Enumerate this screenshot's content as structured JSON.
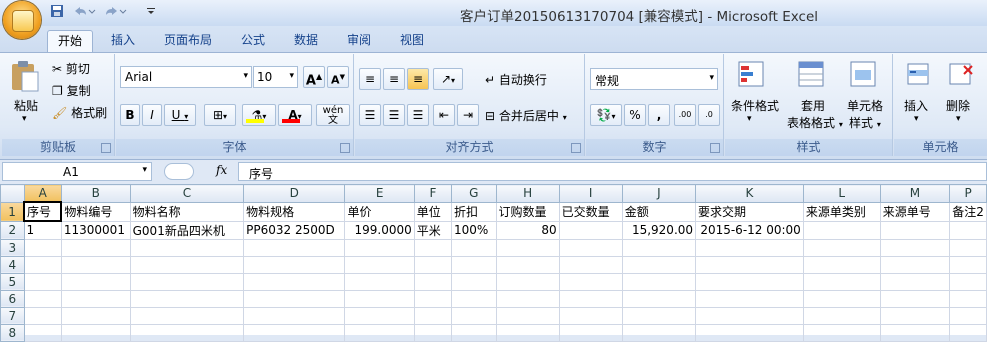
{
  "window": {
    "title": "客户订单20150613170704  [兼容模式] - Microsoft Excel"
  },
  "quick_access": {
    "save": "save-icon",
    "undo": "undo-icon",
    "redo": "redo-icon"
  },
  "tabs": [
    {
      "label": "开始",
      "active": true
    },
    {
      "label": "插入"
    },
    {
      "label": "页面布局"
    },
    {
      "label": "公式"
    },
    {
      "label": "数据"
    },
    {
      "label": "审阅"
    },
    {
      "label": "视图"
    }
  ],
  "ribbon": {
    "clipboard": {
      "paste": "粘贴",
      "cut": "剪切",
      "copy": "复制",
      "format_painter": "格式刷",
      "label": "剪贴板"
    },
    "font": {
      "name": "Arial",
      "size": "10",
      "bold": "B",
      "italic": "I",
      "underline": "U",
      "phonetic": "wén 文",
      "label": "字体",
      "fill_color": "#ffff00",
      "font_color": "#ff0000"
    },
    "alignment": {
      "wrap": "自动换行",
      "merge": "合并后居中",
      "label": "对齐方式"
    },
    "number": {
      "format": "常规",
      "percent": "%",
      "comma": ",",
      "inc_decimal": ".00",
      "dec_decimal": ".0",
      "label": "数字"
    },
    "styles": {
      "conditional": "条件格式",
      "table_format": "套用",
      "table_format_line2": "表格格式",
      "cell_styles": "单元格",
      "cell_styles_line2": "样式",
      "label": "样式"
    },
    "cells": {
      "insert": "插入",
      "delete": "删除",
      "label": "单元格"
    }
  },
  "formula_bar": {
    "name_box": "A1",
    "fx": "fx",
    "content": "序号"
  },
  "sheet": {
    "columns": [
      "A",
      "B",
      "C",
      "D",
      "E",
      "F",
      "G",
      "H",
      "I",
      "J",
      "K",
      "L",
      "M",
      "P"
    ],
    "rows": [
      {
        "num": "1",
        "cells": [
          "序号",
          "物料编号",
          "物料名称",
          "物料规格",
          "单价",
          "单位",
          "折扣",
          "订购数量",
          "已交数量",
          "金额",
          "要求交期",
          "来源单类别",
          "来源单号",
          "备注2"
        ]
      },
      {
        "num": "2",
        "cells": [
          "1",
          "11300001",
          "G001新品四米机",
          "PP6032 2500D",
          "199.0000",
          "平米",
          "100%",
          "80",
          "",
          "15,920.00",
          "2015-6-12 00:00",
          "",
          "",
          " "
        ]
      },
      {
        "num": "3",
        "cells": [
          "",
          "",
          "",
          "",
          "",
          "",
          "",
          "",
          "",
          "",
          "",
          "",
          "",
          ""
        ]
      },
      {
        "num": "4",
        "cells": [
          "",
          "",
          "",
          "",
          "",
          "",
          "",
          "",
          "",
          "",
          "",
          "",
          "",
          ""
        ]
      },
      {
        "num": "5",
        "cells": [
          "",
          "",
          "",
          "",
          "",
          "",
          "",
          "",
          "",
          "",
          "",
          "",
          "",
          ""
        ]
      },
      {
        "num": "6",
        "cells": [
          "",
          "",
          "",
          "",
          "",
          "",
          "",
          "",
          "",
          "",
          "",
          "",
          "",
          ""
        ]
      },
      {
        "num": "7",
        "cells": [
          "",
          "",
          "",
          "",
          "",
          "",
          "",
          "",
          "",
          "",
          "",
          "",
          "",
          ""
        ]
      },
      {
        "num": "8",
        "cells": [
          "",
          "",
          "",
          "",
          "",
          "",
          "",
          "",
          "",
          "",
          "",
          "",
          "",
          ""
        ]
      }
    ]
  }
}
